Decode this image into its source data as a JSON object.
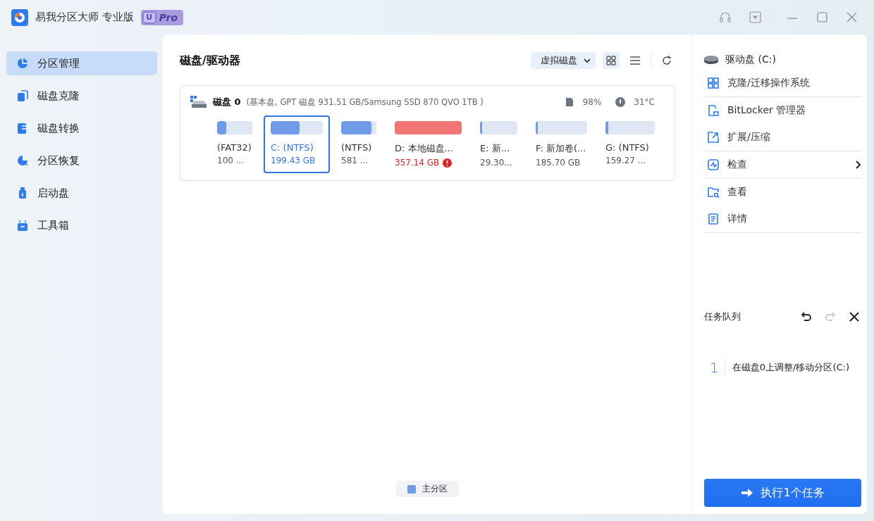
{
  "app": {
    "title": "易我分区大师 专业版",
    "badge_letter": "U",
    "badge_text": "Pro"
  },
  "sidebar": {
    "items": [
      {
        "label": "分区管理",
        "selected": true
      },
      {
        "label": "磁盘克隆",
        "selected": false
      },
      {
        "label": "磁盘转换",
        "selected": false
      },
      {
        "label": "分区恢复",
        "selected": false
      },
      {
        "label": "启动盘",
        "selected": false
      },
      {
        "label": "工具箱",
        "selected": false
      }
    ]
  },
  "main": {
    "title": "磁盘/驱动器",
    "virtual_disk_button": "虚拟磁盘",
    "views": [
      {
        "kind": "grid",
        "selected": true
      },
      {
        "kind": "list",
        "selected": false
      }
    ],
    "disk": {
      "name": "磁盘 0",
      "details": "(基本盘, GPT 磁盘 931.51 GB/Samsung SSD 870 QVO 1TB )",
      "health": "98%",
      "temperature": "31°C",
      "partitions": [
        {
          "label": "(FAT32)",
          "size": "100 ...",
          "level": 0.25,
          "color": "#6f9be8",
          "selected": false,
          "warning": false
        },
        {
          "label": "C: (NTFS)",
          "size": "199.43 GB",
          "level": 0.55,
          "color": "#6f9be8",
          "selected": true,
          "warning": false
        },
        {
          "label": "(NTFS)",
          "size": "581 ...",
          "level": 0.85,
          "color": "#6f9be8",
          "selected": false,
          "warning": false
        },
        {
          "label": "D: 本地磁盘...",
          "size": "357.14 GB",
          "level": 1,
          "color": "#f27676",
          "selected": false,
          "warning": true
        },
        {
          "label": "E: 新...",
          "size": "29.30...",
          "level": 0.05,
          "color": "#6f9be8",
          "selected": false,
          "warning": false
        },
        {
          "label": "F: 新加卷(...",
          "size": "185.70 GB",
          "level": 0.04,
          "color": "#6f9be8",
          "selected": false,
          "warning": false
        },
        {
          "label": "G: (NTFS)",
          "size": "159.27 ...",
          "level": 0.05,
          "color": "#6f9be8",
          "selected": false,
          "warning": false
        }
      ]
    },
    "legend": [
      {
        "label": "主分区",
        "color": "#6f9be8"
      }
    ]
  },
  "actions": {
    "header": "驱动盘  (C:)",
    "groups": [
      [
        {
          "label": "克隆/迁移操作系统",
          "submenu": false
        }
      ],
      [
        {
          "label": "BitLocker 管理器",
          "submenu": false
        },
        {
          "label": "扩展/压缩",
          "submenu": false
        }
      ],
      [
        {
          "label": "检查",
          "submenu": true
        }
      ],
      [
        {
          "label": "查看",
          "submenu": false
        },
        {
          "label": "详情",
          "submenu": false
        }
      ]
    ]
  },
  "task_queue": {
    "title": "任务队列",
    "undo_enabled": true,
    "redo_enabled": false,
    "tasks": [
      {
        "number": "1",
        "text": "在磁盘0上调整/移动分区(C:)"
      }
    ],
    "execute_button": "执行1个任务"
  }
}
